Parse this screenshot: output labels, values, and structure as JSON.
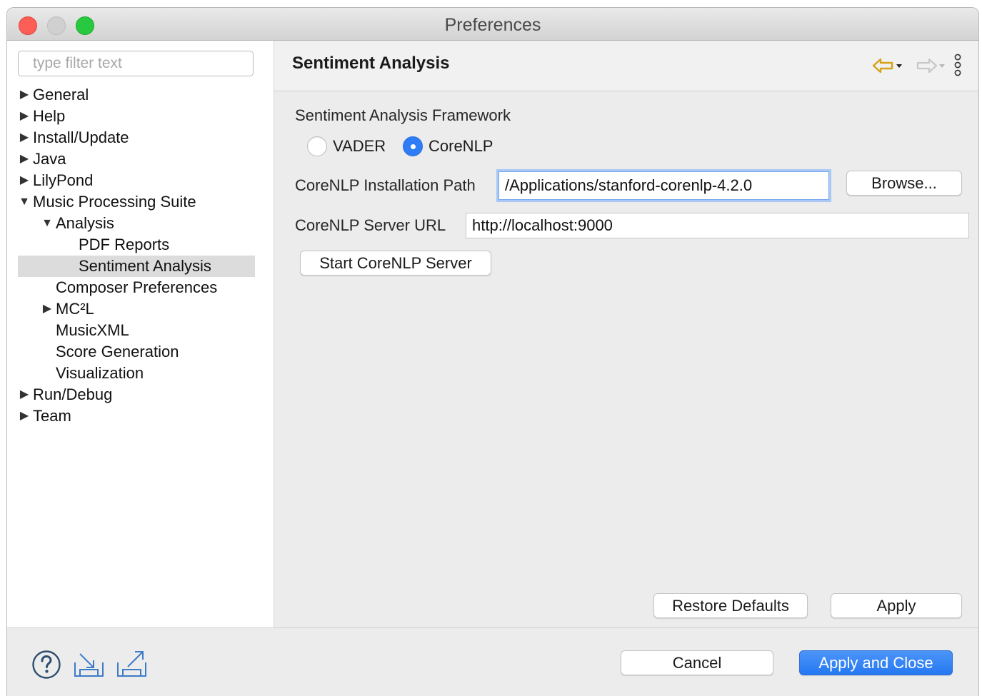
{
  "window": {
    "title": "Preferences"
  },
  "sidebar": {
    "filter_placeholder": "type filter text",
    "tree": [
      {
        "label": "General",
        "expander": "collapsed",
        "level": 0
      },
      {
        "label": "Help",
        "expander": "collapsed",
        "level": 0
      },
      {
        "label": "Install/Update",
        "expander": "collapsed",
        "level": 0
      },
      {
        "label": "Java",
        "expander": "collapsed",
        "level": 0
      },
      {
        "label": "LilyPond",
        "expander": "collapsed",
        "level": 0
      },
      {
        "label": "Music Processing Suite",
        "expander": "expanded",
        "level": 0
      },
      {
        "label": "Analysis",
        "expander": "expanded",
        "level": 1
      },
      {
        "label": "PDF Reports",
        "expander": "none",
        "level": 2
      },
      {
        "label": "Sentiment Analysis",
        "expander": "none",
        "level": 2,
        "selected": true
      },
      {
        "label": "Composer Preferences",
        "expander": "none",
        "level": 1
      },
      {
        "label": "MC²L",
        "expander": "collapsed",
        "level": 1
      },
      {
        "label": "MusicXML",
        "expander": "none",
        "level": 1
      },
      {
        "label": "Score Generation",
        "expander": "none",
        "level": 1
      },
      {
        "label": "Visualization",
        "expander": "none",
        "level": 1
      },
      {
        "label": "Run/Debug",
        "expander": "collapsed",
        "level": 0
      },
      {
        "label": "Team",
        "expander": "collapsed",
        "level": 0
      }
    ]
  },
  "page": {
    "title": "Sentiment Analysis",
    "framework_label": "Sentiment Analysis Framework",
    "radio_options": [
      {
        "label": "VADER",
        "selected": false
      },
      {
        "label": "CoreNLP",
        "selected": true
      }
    ],
    "install_path_label": "CoreNLP Installation Path",
    "install_path_value": "/Applications/stanford-corenlp-4.2.0",
    "browse_label": "Browse...",
    "server_url_label": "CoreNLP Server URL",
    "server_url_value": "http://localhost:9000",
    "start_server_label": "Start CoreNLP Server",
    "restore_defaults_label": "Restore Defaults",
    "apply_label": "Apply"
  },
  "footer": {
    "cancel_label": "Cancel",
    "apply_close_label": "Apply and Close"
  },
  "icons": {
    "back": "back-arrow-icon",
    "forward": "forward-arrow-icon",
    "menu": "view-menu-icon",
    "help": "help-icon",
    "import": "import-icon",
    "export": "export-icon"
  },
  "colors": {
    "accent": "#2f7df6",
    "back_arrow": "#d6a21a",
    "disabled_arrow": "#c8c8c8"
  }
}
